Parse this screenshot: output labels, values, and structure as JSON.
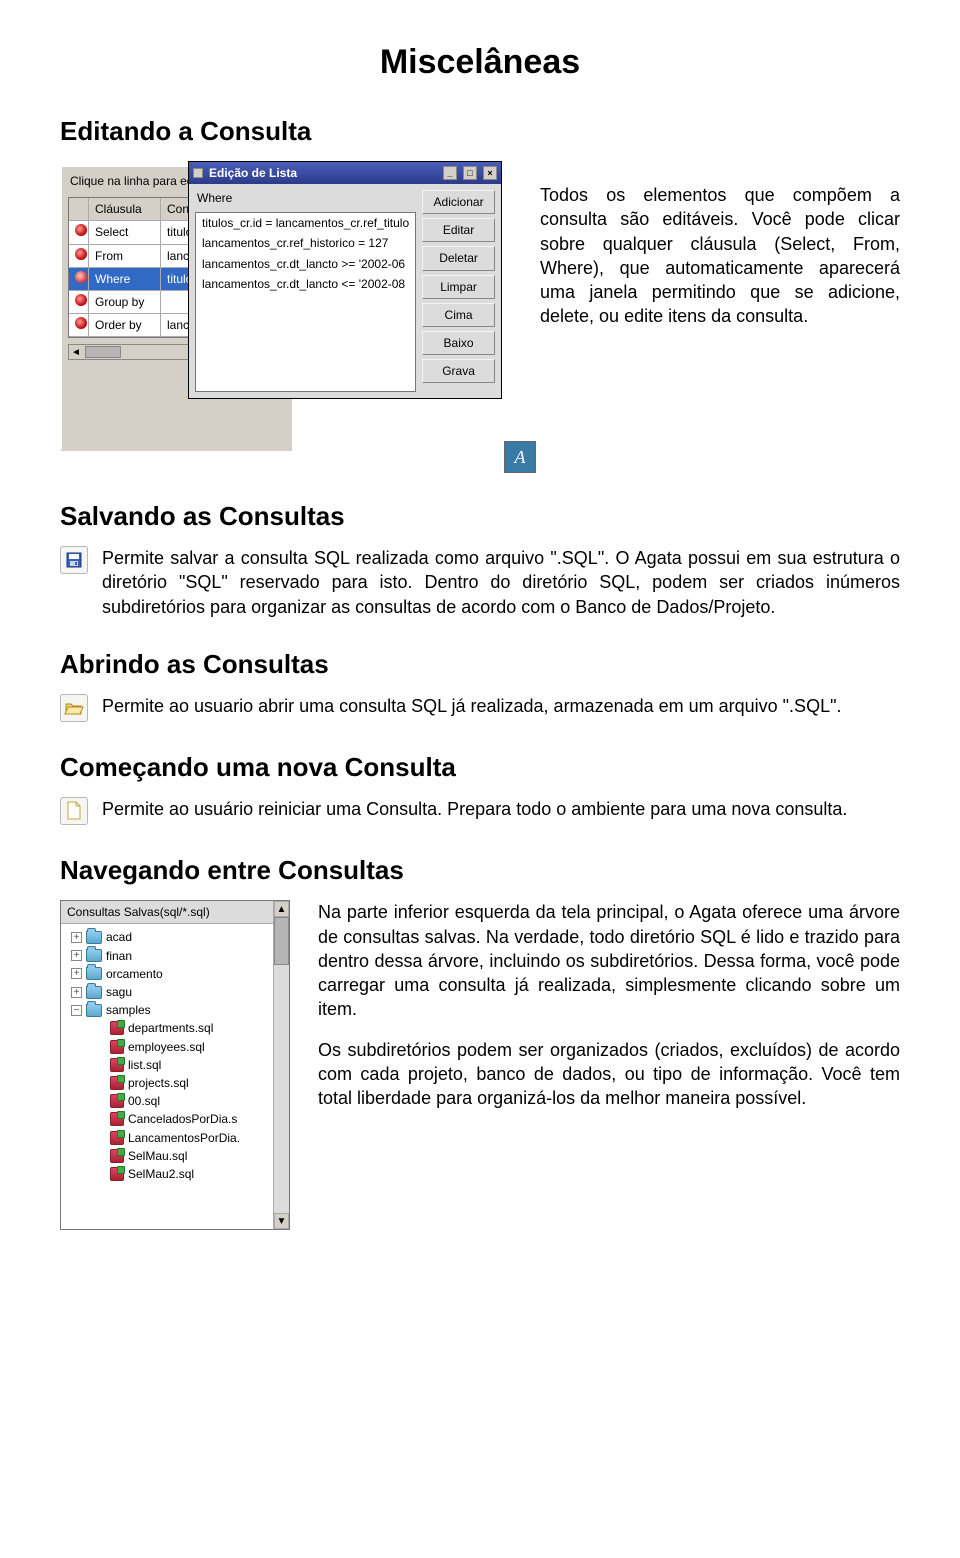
{
  "page_title": "Miscelâneas",
  "sections": {
    "edit": {
      "heading": "Editando a Consulta",
      "paragraph": "Todos os elementos que compõem a consulta são editáveis. Você pode clicar sobre qualquer cláusula (Select, From, Where), que automaticamente aparecerá uma janela permitindo que se adicione, delete, ou edite itens da consulta."
    },
    "save": {
      "heading": "Salvando as Consultas",
      "paragraph": "Permite salvar a consulta SQL realizada como arquivo \".SQL\". O Agata possui em sua estrutura o diretório \"SQL\" reservado para isto. Dentro do diretório SQL, podem ser criados inúmeros subdiretórios para organizar as consultas de acordo com o Banco de Dados/Projeto."
    },
    "open": {
      "heading": "Abrindo as Consultas",
      "paragraph": "Permite ao usuario abrir uma consulta SQL já realizada, armazenada em um arquivo \".SQL\"."
    },
    "new": {
      "heading": "Começando uma nova Consulta",
      "paragraph": "Permite ao usuário reiniciar uma Consulta. Prepara todo o ambiente para uma nova consulta."
    },
    "nav": {
      "heading": "Navegando entre Consultas",
      "p1": "Na parte inferior esquerda da tela principal, o Agata oferece uma árvore de consultas salvas. Na verdade, todo diretório SQL é lido e trazido para dentro dessa árvore, incluindo os subdiretórios. Dessa forma, você pode carregar uma consulta já realizada, simplesmente clicando sobre um item.",
      "p2": "Os subdiretórios podem ser organizados (criados, excluídos) de acordo com cada projeto, banco de dados, ou tipo de informação. Você tem total liberdade para organizá-los da melhor maneira possível."
    }
  },
  "screenshot1": {
    "grid_hint": "Clique na linha para editar o con",
    "columns": {
      "clause": "Cláusula",
      "content": "Conteúdo"
    },
    "rows": [
      {
        "clause": "Select",
        "content": "titulos_cr.id"
      },
      {
        "clause": "From",
        "content": "lancament"
      },
      {
        "clause": "Where",
        "content": "titulos_cr.id",
        "selected": true
      },
      {
        "clause": "Group by",
        "content": ""
      },
      {
        "clause": "Order by",
        "content": "lancament"
      }
    ],
    "dialog": {
      "title": "Edição de Lista",
      "field_label": "Where",
      "items": [
        "titulos_cr.id = lancamentos_cr.ref_titulo",
        "lancamentos_cr.ref_historico = 127",
        "lancamentos_cr.dt_lancto >= '2002-06",
        "lancamentos_cr.dt_lancto <= '2002-08"
      ],
      "buttons": {
        "add": "Adicionar",
        "edit": "Editar",
        "delete": "Deletar",
        "clear": "Limpar",
        "up": "Cima",
        "down": "Baixo",
        "save": "Grava"
      }
    }
  },
  "tree": {
    "title": "Consultas Salvas(sql/*.sql)",
    "folders": [
      "acad",
      "finan",
      "orcamento",
      "sagu",
      "samples"
    ],
    "files": [
      "departments.sql",
      "employees.sql",
      "list.sql",
      "projects.sql",
      "00.sql",
      "CanceladosPorDia.s",
      "LancamentosPorDia.",
      "SelMau.sql",
      "SelMau2.sql"
    ]
  }
}
